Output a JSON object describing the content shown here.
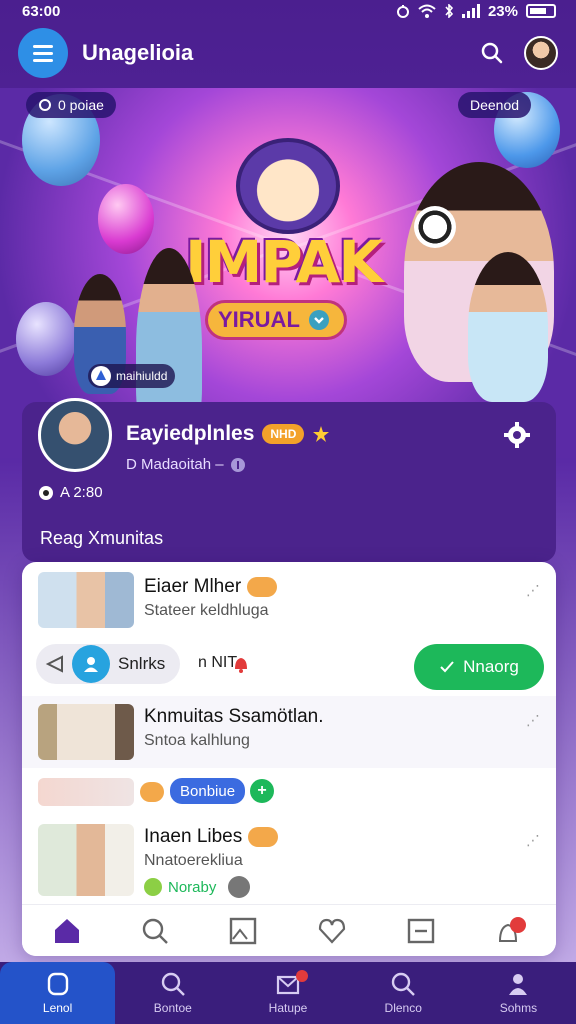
{
  "status": {
    "time": "63:00",
    "battery": "23%"
  },
  "app": {
    "title": "Unagelioia"
  },
  "banner": {
    "left_pill": "0 poiae",
    "right_pill": "Deenod",
    "logo_main": "IMPAK",
    "logo_sub": "YIRUAL",
    "badge_text": "maihiuldd"
  },
  "profile": {
    "name": "Eayiedplnles",
    "badge": "NHD",
    "subtitle": "D Madaoitah –",
    "count": "A 2:80",
    "section_title": "Reag Xmunitas"
  },
  "list": [
    {
      "title": "Eiaer Mlher",
      "subtitle": "Stateer keldhluga"
    },
    {
      "title": "Knmuitas Ssamötlan.",
      "subtitle": "Sntoa kalhlung"
    },
    {
      "title": "Inaen Libes",
      "subtitle": "Nnatoerekliua"
    }
  ],
  "controls": {
    "chip_label": "Snlrks",
    "status_text": "n NIT",
    "join_label": "Nnaorg"
  },
  "row2": {
    "chip_blue": "Bonbiue",
    "chip_green": "+"
  },
  "row3": {
    "footer_text": "Noraby"
  },
  "card_nav": [
    "home-icon",
    "search-icon",
    "gallery-icon",
    "heart-icon",
    "minus-box-icon",
    "notification-icon"
  ],
  "bottom_nav": [
    {
      "label": "Lenol",
      "icon": "home-outline-icon",
      "active": true
    },
    {
      "label": "Bontoe",
      "icon": "search-icon",
      "active": false
    },
    {
      "label": "Hatupe",
      "icon": "mail-icon",
      "active": false
    },
    {
      "label": "Dlenco",
      "icon": "search-icon",
      "active": false
    },
    {
      "label": "Sohms",
      "icon": "person-icon",
      "active": false
    }
  ],
  "colors": {
    "primary": "#4b238c",
    "accent": "#2e8fe6",
    "join": "#1db85a"
  }
}
